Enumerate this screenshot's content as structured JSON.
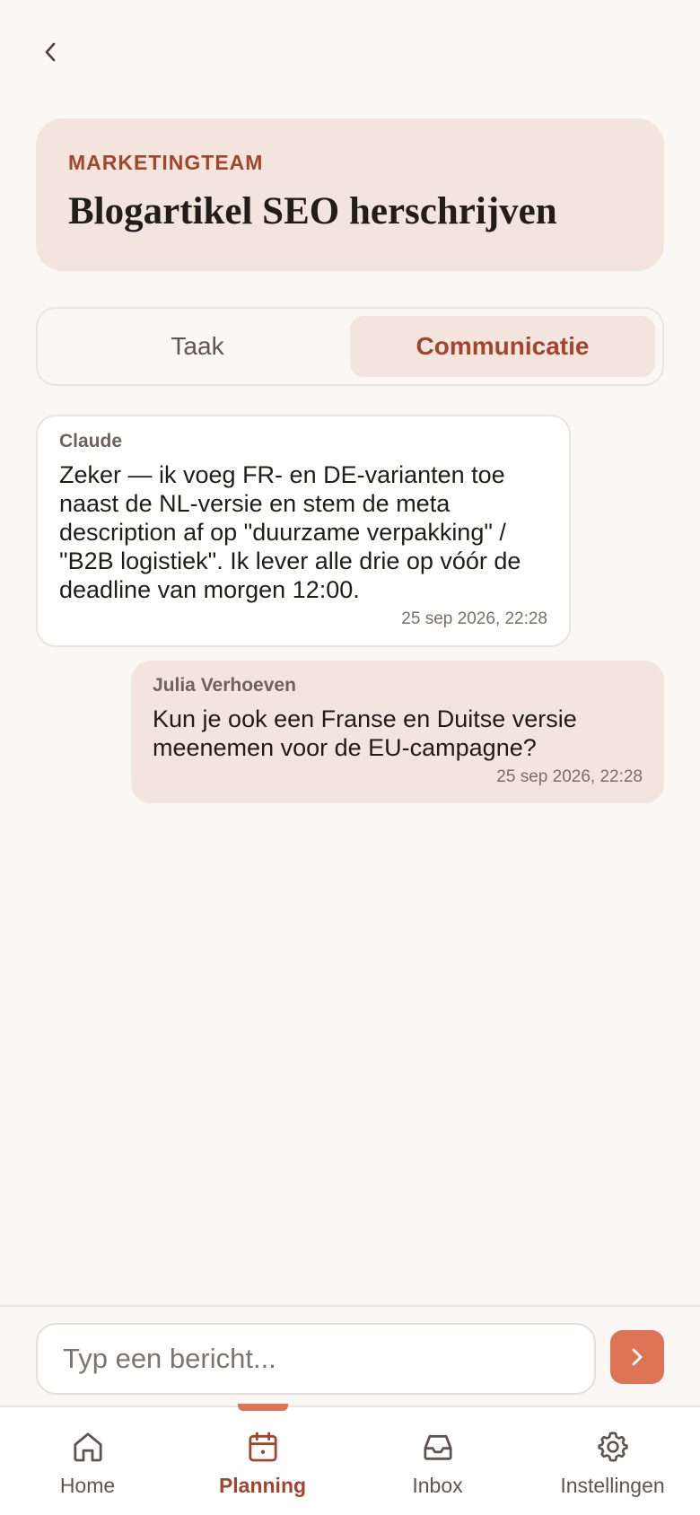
{
  "header": {
    "team": "MARKETINGTEAM",
    "title": "Blogartikel SEO herschrijven"
  },
  "tabs": [
    {
      "label": "Taak",
      "active": false
    },
    {
      "label": "Communicatie",
      "active": true
    }
  ],
  "messages": [
    {
      "sender": "Claude",
      "text": "Zeker — ik voeg FR- en DE-varianten toe naast de NL-versie en stem de meta description af op \"duurzame verpakking\" / \"B2B logistiek\". Ik lever alle drie op vóór de deadline van morgen 12:00.",
      "time": "25 sep 2026, 22:28"
    },
    {
      "sender": "Julia Verhoeven",
      "text": "Kun je ook een Franse en Duitse versie meenemen voor de EU-campagne?",
      "time": "25 sep 2026, 22:28"
    }
  ],
  "composer": {
    "placeholder": "Typ een bericht...",
    "value": ""
  },
  "nav": [
    {
      "label": "Home",
      "icon": "home-icon",
      "active": false
    },
    {
      "label": "Planning",
      "icon": "calendar-icon",
      "active": true
    },
    {
      "label": "Inbox",
      "icon": "inbox-icon",
      "active": false
    },
    {
      "label": "Instellingen",
      "icon": "gear-icon",
      "active": false
    }
  ],
  "colors": {
    "accent": "#df7355",
    "accent_text": "#a2452d",
    "card_bg": "#f3e4dd",
    "page_bg": "#faf7f4"
  }
}
